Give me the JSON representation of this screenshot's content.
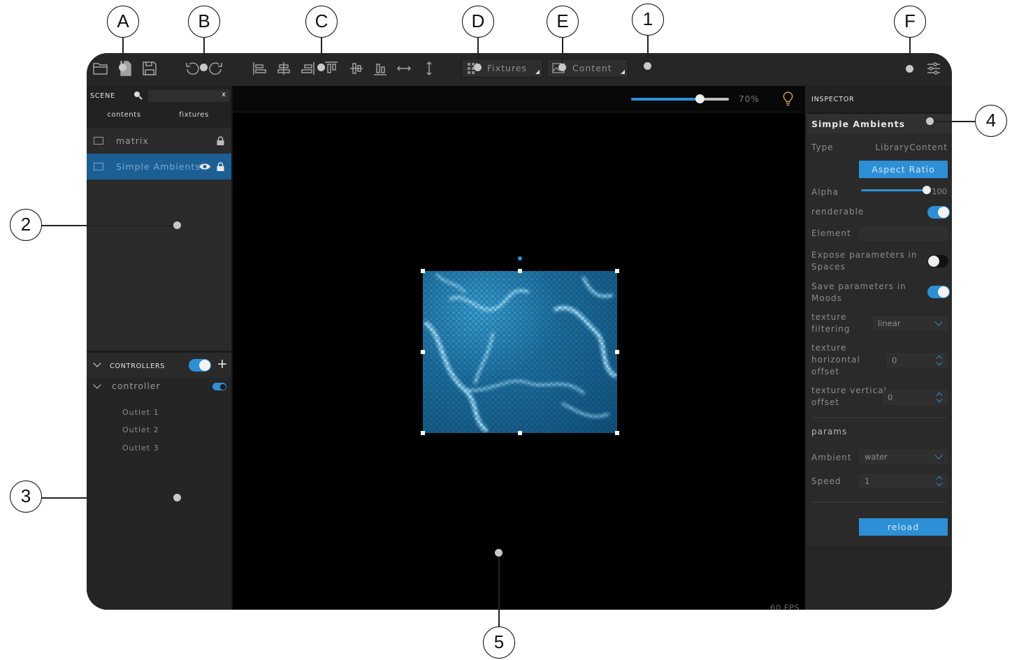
{
  "callouts": {
    "A": "A",
    "B": "B",
    "C": "C",
    "D": "D",
    "E": "E",
    "F": "F",
    "n1": "1",
    "n2": "2",
    "n3": "3",
    "n4": "4",
    "n5": "5"
  },
  "toolbar": {
    "fixtures_label": "Fixtures",
    "content_label": "Content"
  },
  "scene": {
    "title": "SCENE",
    "search_clear": "x",
    "tabs": [
      "contents",
      "fixtures"
    ],
    "items": [
      {
        "label": "matrix",
        "selected": false,
        "locked": true,
        "visible": false
      },
      {
        "label": "Simple Ambients",
        "selected": true,
        "locked": true,
        "visible": true
      }
    ]
  },
  "controllers": {
    "title": "CONTROLLERS",
    "enabled": true,
    "add_symbol": "+",
    "controller": {
      "label": "controller",
      "enabled": true,
      "outlets": [
        "Outlet 1",
        "Outlet 2",
        "Outlet 3"
      ]
    }
  },
  "canvas": {
    "zoom_label": "70%",
    "zoom_value": 0.7,
    "fps": "60 FPS"
  },
  "inspector": {
    "title": "INSPECTOR",
    "object_name": "Simple Ambients",
    "type_label": "Type",
    "type_value": "LibraryContent",
    "aspect_button": "Aspect Ratio",
    "alpha_label": "Alpha",
    "alpha_value": "100",
    "renderable_label": "renderable",
    "renderable": true,
    "element_label": "Element",
    "element_value": "",
    "expose_label_1": "Expose parameters in",
    "expose_label_2": "Spaces",
    "expose": false,
    "save_label_1": "Save parameters in",
    "save_label_2": "Moods",
    "save": true,
    "tex_filter_label_1": "texture",
    "tex_filter_label_2": "filtering",
    "tex_filter_value": "linear",
    "tex_h_label_1": "texture",
    "tex_h_label_2": "horizontal",
    "tex_h_label_3": "offset",
    "tex_h_value": "0",
    "tex_v_label_1": "texture vertical",
    "tex_v_label_2": "offset",
    "tex_v_value": "0",
    "params_label": "params",
    "ambient_label": "Ambient",
    "ambient_value": "water",
    "speed_label": "Speed",
    "speed_value": "1",
    "reload_button": "reload"
  },
  "colors": {
    "accent": "#2d8fd5",
    "panel": "#2b2b2b",
    "canvas": "#000000"
  }
}
